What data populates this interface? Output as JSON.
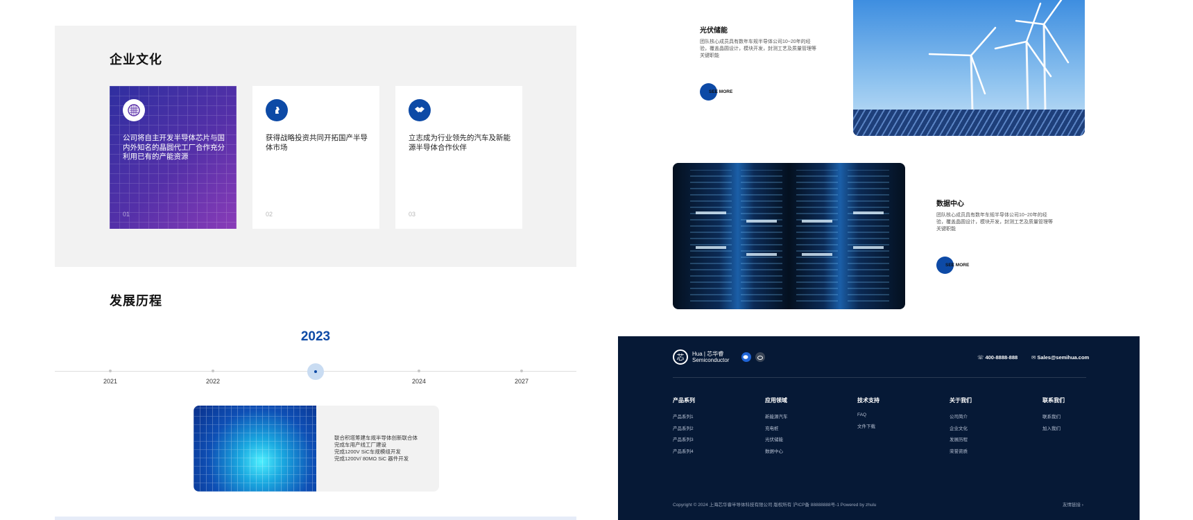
{
  "culture": {
    "title": "企业文化",
    "cards": [
      {
        "icon": "globe-chip-icon",
        "text": "公司将自主开发半导体芯片与国内外知名的晶圆代工厂合作充分利用已有的产能资源",
        "num": "01"
      },
      {
        "icon": "strategy-icon",
        "text": "获得战略投资共同开拓国产半导体市场",
        "num": "02"
      },
      {
        "icon": "handshake-icon",
        "text": "立志成为行业领先的汽车及新能源半导体合作伙伴",
        "num": "03"
      }
    ]
  },
  "history": {
    "title": "发展历程",
    "active_year": "2023",
    "years": [
      "2021",
      "2022",
      "2024",
      "2027"
    ],
    "lines": [
      "联合积塔筹建车规半导体创新联合体",
      "完成车用产线工厂建设",
      "完成1200V SiC车规模组开发",
      "完成1200V/ 80MΩ SiC 器件开发"
    ]
  },
  "apps": [
    {
      "title": "光伏储能",
      "desc": "团队核心成员具有数年车规半导体公司10~20年的经验，覆盖晶圆设计，模块开发，封测工艺及质量管理等关键职能",
      "more": "SEE MORE"
    },
    {
      "title": "数据中心",
      "desc": "团队核心成员具有数年车规半导体公司10~20年的经验，覆盖晶圆设计，模块开发，封测工艺及质量管理等关键职能",
      "more": "SEE MORE"
    }
  ],
  "footer": {
    "logo_line1": "Hua | 芯华睿",
    "logo_line2": "Semiconductor",
    "phone": "400-8888-888",
    "email": "Sales@semihua.com",
    "columns": [
      {
        "heading": "产品系列",
        "items": [
          "产品系列1",
          "产品系列2",
          "产品系列3",
          "产品系列4"
        ]
      },
      {
        "heading": "应用领域",
        "items": [
          "新能源汽车",
          "充电桩",
          "光伏储能",
          "数据中心"
        ]
      },
      {
        "heading": "技术支持",
        "items": [
          "FAQ",
          "文件下载"
        ]
      },
      {
        "heading": "关于我们",
        "items": [
          "公司简介",
          "企业文化",
          "发展历程",
          "荣誉资质"
        ]
      },
      {
        "heading": "联系我们",
        "items": [
          "联系我们",
          "加入我们"
        ]
      }
    ],
    "copyright": "Copyright © 2024 上海芯华睿半导体科技有限公司 版权所有 沪ICP备 88888888号-1 Powered by zhulu",
    "friend_link": "友情链接 ›"
  },
  "colors": {
    "accent": "#0d4aa6",
    "footer_bg": "#061936",
    "panel_bg": "#f2f2f2"
  }
}
